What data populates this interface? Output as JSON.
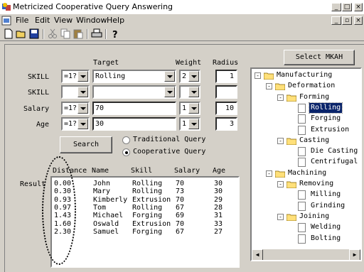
{
  "app": {
    "title": "Metricized Cooperative Query Answering"
  },
  "menu": [
    "File",
    "Edit",
    "View",
    "Window",
    "Help"
  ],
  "toolbar": {
    "icons": [
      "new-icon",
      "open-icon",
      "save-icon",
      "cut-icon",
      "copy-icon",
      "paste-icon",
      "print-icon",
      "help-icon"
    ]
  },
  "headers": {
    "target": "Target",
    "weight": "Weight",
    "radius": "Radius"
  },
  "rows": [
    {
      "label": "SKILL",
      "op": "=1?",
      "target": "Rolling",
      "weight": "2",
      "radius": "1"
    },
    {
      "label": "SKILL",
      "op": "",
      "target": "",
      "weight": "",
      "radius": ""
    },
    {
      "label": "Salary",
      "op": "=1?",
      "target": "70",
      "weight": "1",
      "radius": "10"
    },
    {
      "label": "Age",
      "op": "=1?",
      "target": "30",
      "weight": "1",
      "radius": "3"
    }
  ],
  "search_label": "Search",
  "query_modes": {
    "traditional": "Traditional Query",
    "cooperative": "Cooperative Query",
    "selected": "cooperative"
  },
  "select_button": "Select MKAH",
  "result_label": "Result",
  "results": {
    "columns": [
      "Distance",
      "Name",
      "Skill",
      "Salary",
      "Age"
    ],
    "rows": [
      [
        "0.00",
        "John",
        "Rolling",
        "70",
        "30"
      ],
      [
        "0.30",
        "Mary",
        "Rolling",
        "73",
        "30"
      ],
      [
        "0.93",
        "Kimberly",
        "Extrusion",
        "70",
        "29"
      ],
      [
        "0.97",
        "Tom",
        "Rolling",
        "67",
        "28"
      ],
      [
        "1.43",
        "Michael",
        "Forging",
        "69",
        "31"
      ],
      [
        "1.60",
        "Oswald",
        "Extrusion",
        "70",
        "33"
      ],
      [
        "2.30",
        "Samuel",
        "Forging",
        "67",
        "27"
      ]
    ]
  },
  "tree": [
    {
      "label": "Manufacturing",
      "type": "folder",
      "expander": "-"
    },
    {
      "label": "Deformation",
      "type": "folder",
      "expander": "-"
    },
    {
      "label": "Forming",
      "type": "folder",
      "expander": "-"
    },
    {
      "label": "Rolling",
      "type": "doc",
      "selected": true
    },
    {
      "label": "Forging",
      "type": "doc"
    },
    {
      "label": "Extrusion",
      "type": "doc"
    },
    {
      "label": "Casting",
      "type": "folder",
      "expander": "-"
    },
    {
      "label": "Die Casting",
      "type": "doc"
    },
    {
      "label": "Centrifugal C",
      "type": "doc"
    },
    {
      "label": "Machining",
      "type": "folder",
      "expander": "-"
    },
    {
      "label": "Removing",
      "type": "folder",
      "expander": "-"
    },
    {
      "label": "Milling",
      "type": "doc"
    },
    {
      "label": "Grinding",
      "type": "doc"
    },
    {
      "label": "Joining",
      "type": "folder",
      "expander": "-"
    },
    {
      "label": "Welding",
      "type": "doc"
    },
    {
      "label": "Bolting",
      "type": "doc"
    }
  ],
  "colors": {
    "selection": "#0a246a",
    "face": "#d4d0c8",
    "folder": "#ffe07a"
  }
}
